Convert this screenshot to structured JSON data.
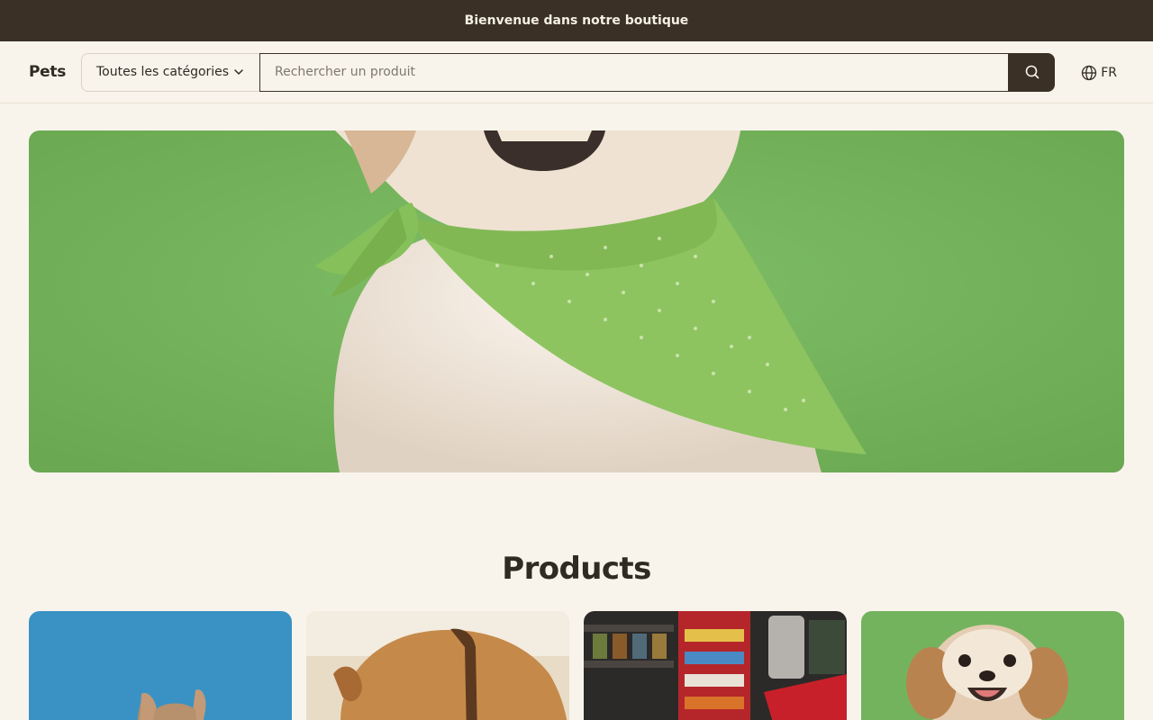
{
  "announcement": "Bienvenue dans notre boutique",
  "header": {
    "logo": "Pets",
    "category_select": "Toutes les catégories",
    "search_placeholder": "Rechercher un produit",
    "language": "FR"
  },
  "sections": {
    "products_title": "Products"
  },
  "icons": [
    "chevron-down-icon",
    "search-icon",
    "globe-icon"
  ],
  "colors": {
    "background": "#f8f4ec",
    "dark": "#3a3026",
    "hero_green": "#74b35d"
  }
}
